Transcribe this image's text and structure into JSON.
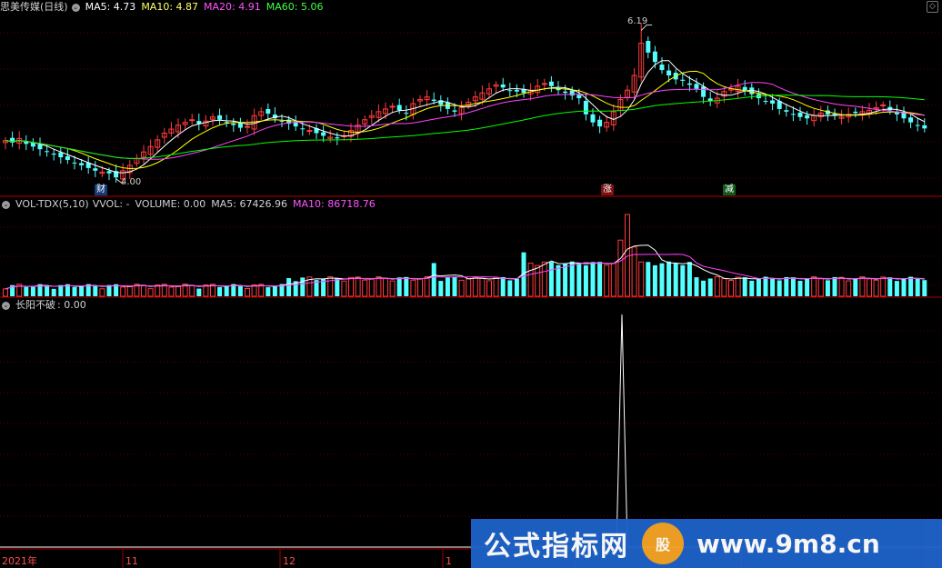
{
  "header1": {
    "title": "思美传媒(日线)",
    "ma5": "MA5: 4.73",
    "ma10": "MA10: 4.87",
    "ma20": "MA20: 4.91",
    "ma60": "MA60: 5.06"
  },
  "header2": {
    "title": "VOL-TDX(5,10)",
    "vvol": "VVOL: -",
    "volume": "VOLUME: 0.00",
    "ma5": "MA5: 67426.96",
    "ma10": "MA10: 86718.76"
  },
  "header3": {
    "title": "长阳不破",
    "value": ": 0.00"
  },
  "annotations": {
    "high": "6.19",
    "low": "4.00",
    "cai": "财",
    "zhang": "涨",
    "jian": "减"
  },
  "xaxis": {
    "labels": [
      "2021年",
      "11",
      "12",
      "1"
    ]
  },
  "watermark": {
    "text": "公式指标网",
    "site": "www.9m8.cn",
    "logo": "股"
  },
  "colors": {
    "up": "#ff3c3c",
    "down": "#54ffff",
    "ma5": "#ffffff",
    "ma10": "#ffff00",
    "ma20": "#ff44ff",
    "ma60": "#00ff00",
    "frame": "#b00000"
  },
  "chart_data": {
    "type": "candlestick",
    "series_close": [
      4.55,
      4.52,
      4.58,
      4.5,
      4.46,
      4.42,
      4.38,
      4.34,
      4.3,
      4.26,
      4.22,
      4.18,
      4.14,
      4.1,
      4.08,
      4.06,
      4.0,
      4.1,
      4.18,
      4.28,
      4.38,
      4.46,
      4.56,
      4.66,
      4.72,
      4.78,
      4.82,
      4.86,
      4.8,
      4.84,
      4.9,
      4.86,
      4.82,
      4.78,
      4.74,
      4.76,
      4.92,
      4.98,
      4.95,
      4.88,
      4.84,
      4.8,
      4.76,
      4.72,
      4.7,
      4.66,
      4.62,
      4.6,
      4.58,
      4.62,
      4.7,
      4.78,
      4.86,
      4.92,
      4.98,
      5.02,
      5.06,
      5.0,
      4.95,
      5.1,
      5.16,
      5.2,
      5.14,
      5.08,
      5.02,
      4.98,
      5.04,
      5.12,
      5.2,
      5.26,
      5.32,
      5.38,
      5.34,
      5.3,
      5.28,
      5.26,
      5.3,
      5.36,
      5.4,
      5.36,
      5.3,
      5.26,
      5.22,
      5.18,
      4.94,
      4.82,
      4.76,
      4.82,
      4.98,
      5.16,
      5.3,
      5.52,
      6.0,
      5.86,
      5.72,
      5.6,
      5.52,
      5.46,
      5.44,
      5.38,
      5.32,
      5.2,
      5.14,
      5.18,
      5.28,
      5.32,
      5.36,
      5.3,
      5.24,
      5.18,
      5.14,
      5.1,
      5.02,
      4.98,
      4.94,
      4.9,
      4.88,
      4.92,
      4.96,
      4.94,
      4.92,
      4.9,
      4.94,
      4.96,
      4.98,
      5.0,
      5.04,
      5.08,
      5.0,
      4.94,
      4.88,
      4.82,
      4.78,
      4.73
    ],
    "volume_spikes": {
      "max_index": 90,
      "max_rel": 1.0
    },
    "signal": {
      "type": "line",
      "spike_index": 90,
      "spike_rel": 1.0
    },
    "ylim_price": [
      3.8,
      6.4
    ]
  }
}
